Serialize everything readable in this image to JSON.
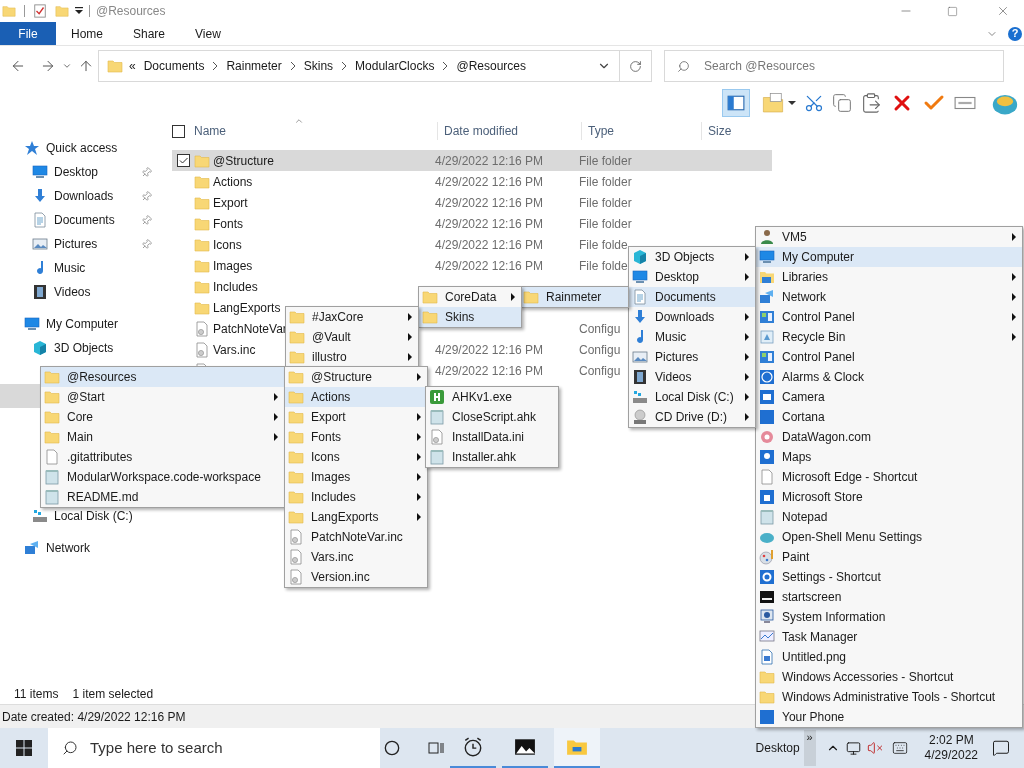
{
  "window": {
    "title": "@Resources"
  },
  "ribbon": {
    "file_tab": "File",
    "tabs": [
      {
        "label": "Home",
        "selected": false
      },
      {
        "label": "Share",
        "selected": false
      },
      {
        "label": "View",
        "selected": false
      }
    ],
    "help": "?"
  },
  "address": {
    "overflow": "«",
    "crumbs": [
      "Documents",
      "Rainmeter",
      "Skins",
      "ModularClocks",
      "@Resources"
    ]
  },
  "search": {
    "placeholder": "Search @Resources"
  },
  "toolbar": {
    "panes_on": true
  },
  "nav": [
    {
      "kind": "header",
      "label": "Quick access",
      "selected": false
    },
    {
      "kind": "item",
      "label": "Desktop",
      "pinned": true,
      "selected": false
    },
    {
      "kind": "item",
      "label": "Downloads",
      "pinned": true,
      "selected": false
    },
    {
      "kind": "item",
      "label": "Documents",
      "pinned": true,
      "selected": false
    },
    {
      "kind": "item",
      "label": "Pictures",
      "pinned": true,
      "selected": false
    },
    {
      "kind": "item",
      "label": "Music",
      "pinned": false,
      "selected": false
    },
    {
      "kind": "item",
      "label": "Videos",
      "pinned": false,
      "selected": false
    },
    {
      "kind": "header",
      "label": "My Computer",
      "selected": false
    },
    {
      "kind": "item",
      "label": "3D Objects",
      "pinned": false,
      "selected": false
    },
    {
      "kind": "covered",
      "selected": false
    },
    {
      "kind": "covered",
      "selected": true
    },
    {
      "kind": "covered",
      "selected": false
    },
    {
      "kind": "covered",
      "selected": false
    },
    {
      "kind": "covered",
      "selected": false
    },
    {
      "kind": "covered",
      "selected": false
    },
    {
      "kind": "item",
      "label": "Local Disk (C:)",
      "pinned": false,
      "selected": false
    },
    {
      "kind": "header",
      "label": "Network",
      "selected": false
    }
  ],
  "select_all": {
    "checked": false
  },
  "columns": [
    "Name",
    "Date modified",
    "Type",
    "Size"
  ],
  "rows": [
    {
      "name": "@Structure",
      "date": "4/29/2022 12:16 PM",
      "type": "File folder",
      "selected": true,
      "file": false
    },
    {
      "name": "Actions",
      "date": "4/29/2022 12:16 PM",
      "type": "File folder",
      "selected": false,
      "file": false
    },
    {
      "name": "Export",
      "date": "4/29/2022 12:16 PM",
      "type": "File folder",
      "selected": false,
      "file": false
    },
    {
      "name": "Fonts",
      "date": "4/29/2022 12:16 PM",
      "type": "File folder",
      "selected": false,
      "file": false
    },
    {
      "name": "Icons",
      "date": "4/29/2022 12:16 PM",
      "type": "File folde",
      "selected": false,
      "file": false
    },
    {
      "name": "Images",
      "date": "4/29/2022 12:16 PM",
      "type": "File folde",
      "selected": false,
      "file": false
    },
    {
      "name": "Includes",
      "selected": false,
      "file": false
    },
    {
      "name": "LangExports",
      "selected": false,
      "file": false
    },
    {
      "name": "PatchNoteVar",
      "type": "Configu",
      "selected": false,
      "file": true
    },
    {
      "name": "Vars.inc",
      "date": "4/29/2022 12:16 PM",
      "type": "Configu",
      "selected": false,
      "file": true
    },
    {
      "date": "4/29/2022 12:16 PM",
      "type": "Configu",
      "selected": false,
      "file": true
    }
  ],
  "status": {
    "count": "11 items",
    "selection": "1 item selected"
  },
  "details": "Date created: 4/29/2022 12:16 PM",
  "menus": [
    {
      "items": [
        {
          "label": "VM5",
          "submenu": true,
          "selected": false
        },
        {
          "label": "My Computer",
          "submenu": false,
          "selected": true
        },
        {
          "label": "Libraries",
          "submenu": true,
          "selected": false
        },
        {
          "label": "Network",
          "submenu": true,
          "selected": false
        },
        {
          "label": "Control Panel",
          "submenu": true,
          "selected": false
        },
        {
          "label": "Recycle Bin",
          "submenu": true,
          "selected": false
        },
        {
          "label": "Control Panel",
          "submenu": false,
          "selected": false
        },
        {
          "label": "Alarms & Clock",
          "submenu": false,
          "selected": false
        },
        {
          "label": "Camera",
          "submenu": false,
          "selected": false
        },
        {
          "label": "Cortana",
          "submenu": false,
          "selected": false
        },
        {
          "label": "DataWagon.com",
          "submenu": false,
          "selected": false
        },
        {
          "label": "Maps",
          "submenu": false,
          "selected": false
        },
        {
          "label": "Microsoft Edge - Shortcut",
          "submenu": false,
          "selected": false
        },
        {
          "label": "Microsoft Store",
          "submenu": false,
          "selected": false
        },
        {
          "label": "Notepad",
          "submenu": false,
          "selected": false
        },
        {
          "label": "Open-Shell Menu Settings",
          "submenu": false,
          "selected": false
        },
        {
          "label": "Paint",
          "submenu": false,
          "selected": false
        },
        {
          "label": "Settings - Shortcut",
          "submenu": false,
          "selected": false
        },
        {
          "label": "startscreen",
          "submenu": false,
          "selected": false
        },
        {
          "label": "System Information",
          "submenu": false,
          "selected": false
        },
        {
          "label": "Task Manager",
          "submenu": false,
          "selected": false
        },
        {
          "label": "Untitled.png",
          "submenu": false,
          "selected": false
        },
        {
          "label": "Windows Accessories - Shortcut",
          "submenu": false,
          "selected": false
        },
        {
          "label": "Windows Administrative Tools - Shortcut",
          "submenu": false,
          "selected": false
        },
        {
          "label": "Your Phone",
          "submenu": false,
          "selected": false
        }
      ]
    },
    {
      "items": [
        {
          "label": "3D Objects",
          "submenu": true,
          "selected": false
        },
        {
          "label": "Desktop",
          "submenu": true,
          "selected": false
        },
        {
          "label": "Documents",
          "submenu": false,
          "selected": true
        },
        {
          "label": "Downloads",
          "submenu": true,
          "selected": false
        },
        {
          "label": "Music",
          "submenu": true,
          "selected": false
        },
        {
          "label": "Pictures",
          "submenu": true,
          "selected": false
        },
        {
          "label": "Videos",
          "submenu": true,
          "selected": false
        },
        {
          "label": "Local Disk (C:)",
          "submenu": true,
          "selected": false
        },
        {
          "label": "CD Drive (D:)",
          "submenu": true,
          "selected": false
        }
      ]
    },
    {
      "items": [
        {
          "label": "Rainmeter",
          "submenu": false,
          "selected": true
        }
      ]
    },
    {
      "items": [
        {
          "label": "CoreData",
          "submenu": true,
          "selected": false
        },
        {
          "label": "Skins",
          "submenu": false,
          "selected": true
        }
      ]
    },
    {
      "items": [
        {
          "label": "#JaxCore",
          "submenu": true,
          "selected": false
        },
        {
          "label": "@Vault",
          "submenu": true,
          "selected": false
        },
        {
          "label": "illustro",
          "submenu": true,
          "selected": false
        }
      ]
    },
    {
      "items": [
        {
          "label": "@Resources",
          "submenu": false,
          "selected": true
        },
        {
          "label": "@Start",
          "submenu": true,
          "selected": false
        },
        {
          "label": "Core",
          "submenu": true,
          "selected": false
        },
        {
          "label": "Main",
          "submenu": true,
          "selected": false
        },
        {
          "label": ".gitattributes",
          "submenu": false,
          "selected": false
        },
        {
          "label": "ModularWorkspace.code-workspace",
          "submenu": false,
          "selected": false
        },
        {
          "label": "README.md",
          "submenu": false,
          "selected": false
        }
      ]
    },
    {
      "items": [
        {
          "label": "@Structure",
          "submenu": true,
          "selected": false
        },
        {
          "label": "Actions",
          "submenu": false,
          "selected": true
        },
        {
          "label": "Export",
          "submenu": true,
          "selected": false
        },
        {
          "label": "Fonts",
          "submenu": true,
          "selected": false
        },
        {
          "label": "Icons",
          "submenu": true,
          "selected": false
        },
        {
          "label": "Images",
          "submenu": true,
          "selected": false
        },
        {
          "label": "Includes",
          "submenu": true,
          "selected": false
        },
        {
          "label": "LangExports",
          "submenu": true,
          "selected": false
        },
        {
          "label": "PatchNoteVar.inc",
          "submenu": false,
          "selected": false
        },
        {
          "label": "Vars.inc",
          "submenu": false,
          "selected": false
        },
        {
          "label": "Version.inc",
          "submenu": false,
          "selected": false
        }
      ]
    },
    {
      "items": [
        {
          "label": "AHKv1.exe",
          "submenu": false,
          "selected": false
        },
        {
          "label": "CloseScript.ahk",
          "submenu": false,
          "selected": false
        },
        {
          "label": "InstallData.ini",
          "submenu": false,
          "selected": false
        },
        {
          "label": "Installer.ahk",
          "submenu": false,
          "selected": false
        }
      ]
    }
  ],
  "taskbar": {
    "search_placeholder": "Type here to search",
    "apps": [
      {
        "active": false
      },
      {
        "active": false
      },
      {
        "active": true
      }
    ],
    "desktop": "Desktop",
    "overflow": "»",
    "time": "2:02 PM",
    "date": "4/29/2022"
  }
}
